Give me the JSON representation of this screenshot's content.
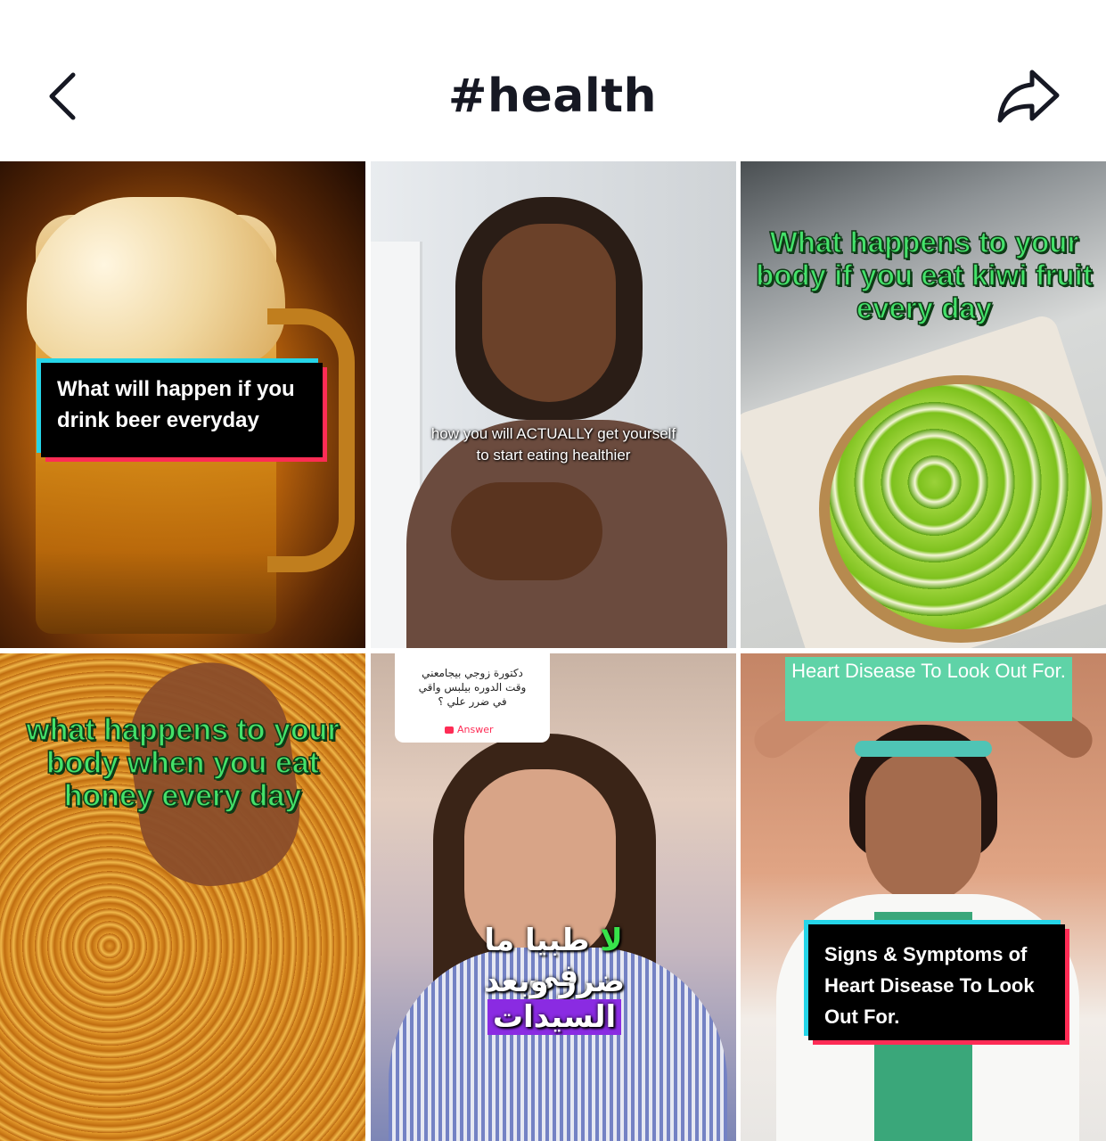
{
  "header": {
    "title": "#health",
    "back_icon": "chevron-left-icon",
    "share_icon": "share-arrow-icon"
  },
  "videos": [
    {
      "caption": "What will happen if you drink beer everyday"
    },
    {
      "caption": "how you will ACTUALLY get yourself to start eating healthier"
    },
    {
      "caption": "What happens to your body if you eat kiwi fruit every day"
    },
    {
      "caption": "what happens to your body when you eat honey every day"
    },
    {
      "comment_line1": "دكتورة زوجي بيجامعني",
      "comment_line2": "وقت الدوره بيلبس واقي",
      "comment_line3": "في ضرر علي ؟",
      "answer_label": "Answer",
      "caption_line1_green": "لا",
      "caption_line1_rest": "طبيا ما في",
      "caption_line2_rest": "ضرر وبعد",
      "caption_line2_highlight": "السيدات"
    },
    {
      "banner": "Heart Disease To Look Out For.",
      "caption": "Signs & Symptoms of Heart Disease To Look Out For."
    }
  ],
  "colors": {
    "caption_green": "#44e26a",
    "accent_cyan": "#25d5e8",
    "accent_pink": "#fe2c55",
    "banner_teal": "#5fd3a7",
    "highlight_purple": "#8a2be2"
  }
}
